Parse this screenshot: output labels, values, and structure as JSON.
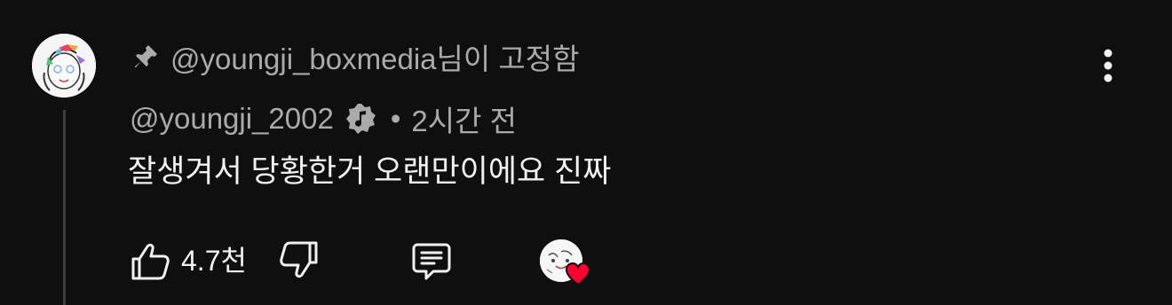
{
  "pinned": {
    "text": "@youngji_boxmedia님이 고정함",
    "icon": "pin-icon"
  },
  "comment": {
    "author": "@youngji_2002",
    "verified_icon": "music-note-badge-icon",
    "separator": "•",
    "timestamp": "2시간 전",
    "text": "잘생겨서 당황한거 오랜만이에요 진짜"
  },
  "actions": {
    "like_count": "4.7천",
    "like_icon": "thumbs-up-icon",
    "dislike_icon": "thumbs-down-icon",
    "reply_icon": "reply-comment-icon",
    "creator_heart_icon": "heart-icon"
  },
  "menu": {
    "icon": "more-vert-icon"
  },
  "colors": {
    "background": "#0f0f0f",
    "primary_text": "#f1f1f1",
    "secondary_text": "#aaaaaa",
    "heart": "#ff0033"
  }
}
